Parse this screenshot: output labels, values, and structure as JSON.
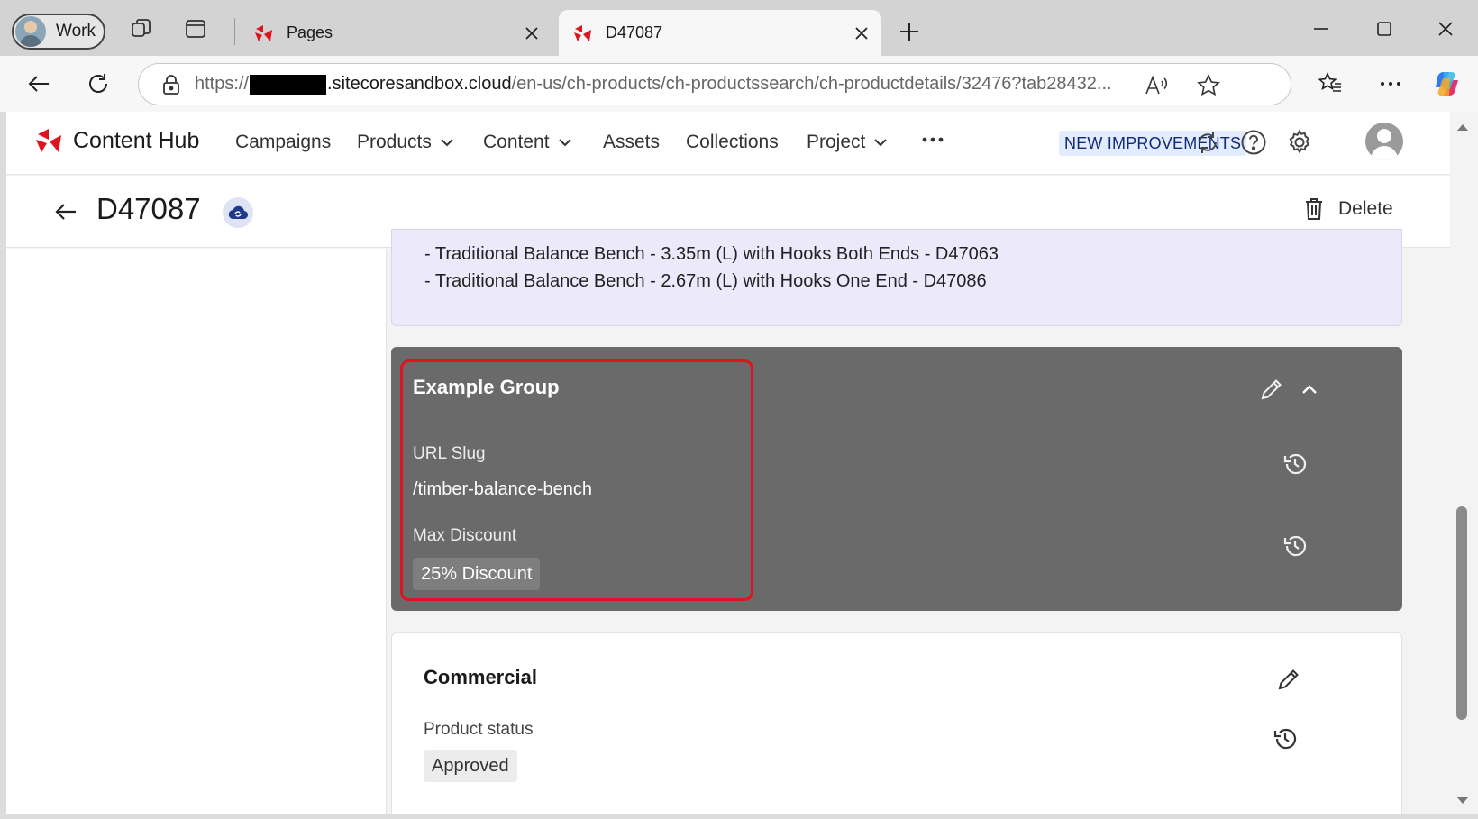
{
  "browser": {
    "profile_label": "Work",
    "tabs": [
      {
        "title": "Pages",
        "active": false
      },
      {
        "title": "D47087",
        "active": true
      }
    ],
    "url_prefix": "https://",
    "url_host": ".sitecoresandbox.cloud",
    "url_path": "/en-us/ch-products/ch-productssearch/ch-productdetails/32476?tab28432..."
  },
  "app": {
    "brand": "Content Hub",
    "brand_color": "#e0141e",
    "menu": [
      {
        "label": "Campaigns",
        "dropdown": false
      },
      {
        "label": "Products",
        "dropdown": true
      },
      {
        "label": "Content",
        "dropdown": true
      },
      {
        "label": "Assets",
        "dropdown": false
      },
      {
        "label": "Collections",
        "dropdown": false
      },
      {
        "label": "Project",
        "dropdown": true
      }
    ],
    "improvements_badge": "NEW IMPROVEMENTS"
  },
  "page": {
    "title": "D47087",
    "delete_label": "Delete"
  },
  "related_products": [
    "- Traditional Balance Bench - 3.35m (L) with Hooks Both Ends - D47063",
    "- Traditional Balance Bench - 2.67m (L) with Hooks One End - D47086"
  ],
  "example_group": {
    "title": "Example Group",
    "url_slug_label": "URL Slug",
    "url_slug_value": "/timber-balance-bench",
    "max_discount_label": "Max Discount",
    "max_discount_value": "25% Discount",
    "highlight_color": "#e0141e"
  },
  "commercial": {
    "title": "Commercial",
    "product_status_label": "Product status",
    "product_status_value": "Approved"
  }
}
